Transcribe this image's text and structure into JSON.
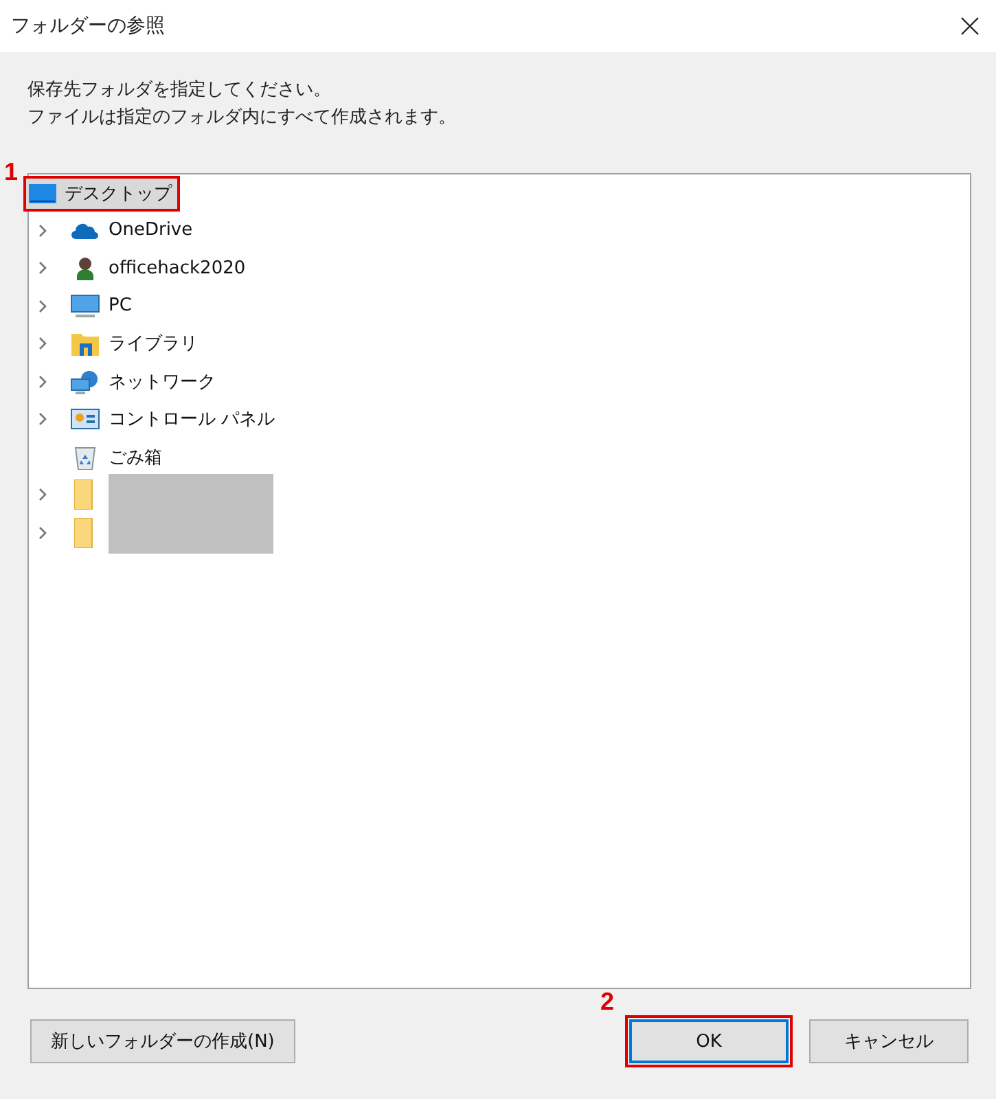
{
  "window": {
    "title": "フォルダーの参照"
  },
  "instructions": [
    "保存先フォルダを指定してください。",
    "ファイルは指定のフォルダ内にすべて作成されます。"
  ],
  "tree": {
    "root": {
      "label": "デスクトップ",
      "kind": "desktop",
      "selected": true,
      "callout": "1"
    },
    "items": [
      {
        "label": "OneDrive",
        "kind": "cloud",
        "expandable": true,
        "redacted": false
      },
      {
        "label": "officehack2020",
        "kind": "user",
        "expandable": true,
        "redacted": false
      },
      {
        "label": "PC",
        "kind": "pc",
        "expandable": true,
        "redacted": false
      },
      {
        "label": "ライブラリ",
        "kind": "library",
        "expandable": true,
        "redacted": false
      },
      {
        "label": "ネットワーク",
        "kind": "network",
        "expandable": true,
        "redacted": false
      },
      {
        "label": "コントロール パネル",
        "kind": "control-panel",
        "expandable": true,
        "redacted": false
      },
      {
        "label": "ごみ箱",
        "kind": "recycle-bin",
        "expandable": false,
        "redacted": false
      },
      {
        "kind": "folder",
        "expandable": true,
        "redacted": true
      },
      {
        "kind": "folder",
        "expandable": true,
        "redacted": true
      }
    ]
  },
  "buttons": [
    {
      "label": "新しいフォルダーの作成(N)",
      "default": false
    },
    {
      "label": "OK",
      "default": true,
      "callout": "2"
    },
    {
      "label": "キャンセル",
      "default": false
    }
  ]
}
